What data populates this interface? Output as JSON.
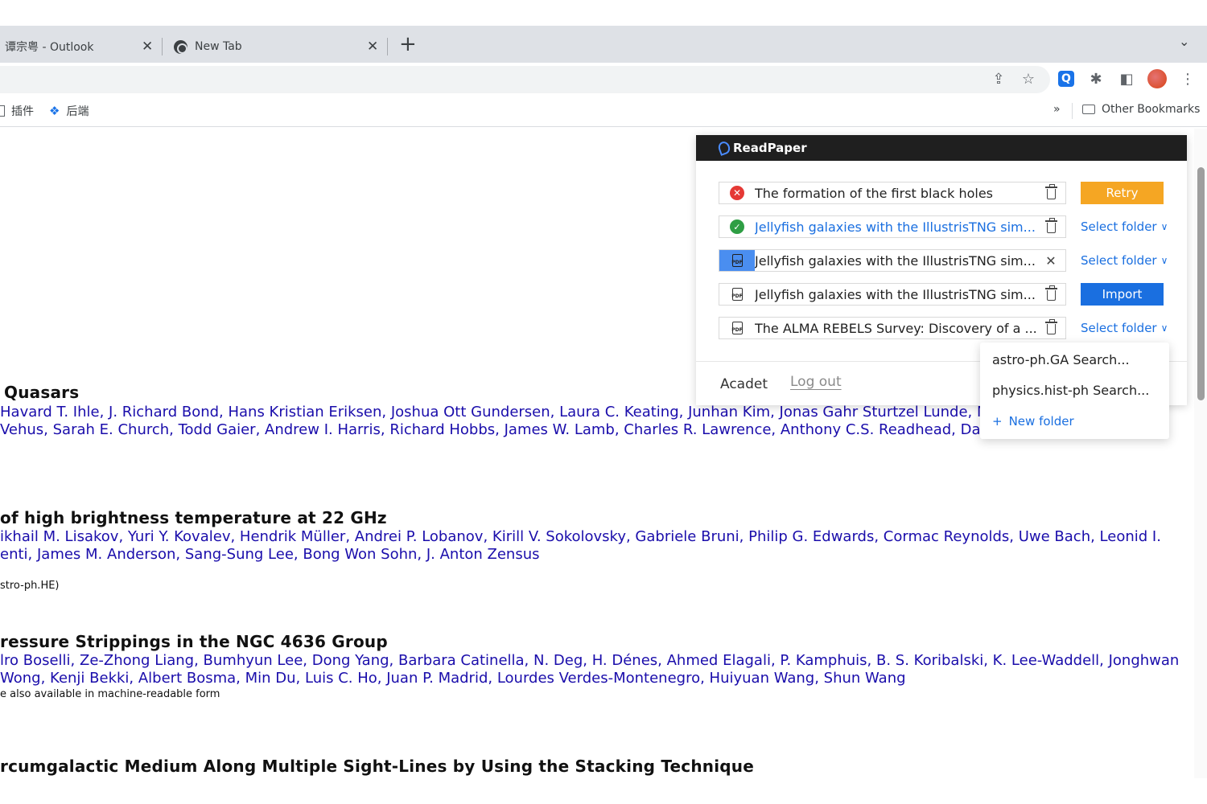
{
  "browser": {
    "tabs": [
      {
        "title": "谭宗粤 - Outlook"
      },
      {
        "title": "New Tab"
      }
    ],
    "new_tab_symbol": "+",
    "tab_menu_symbol": "⌄",
    "bookmarks": [
      {
        "label": "插件"
      },
      {
        "label": "后端"
      }
    ],
    "bookmarks_overflow": "»",
    "other_bookmarks": "Other Bookmarks",
    "extension_letter": "Q"
  },
  "papers": [
    {
      "title": "Quasars",
      "authors_line1": "Havard T. Ihle, J. Richard Bond, Hans Kristian Eriksen, Joshua Ott Gundersen, Laura C. Keating, Junhan Kim, Jonas Gahr Sturtzel Lunde, N",
      "authors_line2": "Vehus, Sarah E. Church, Todd Gaier, Andrew I. Harris, Richard Hobbs, James W. Lamb, Charles R. Lawrence, Anthony C.S. Readhead, Dav",
      "note": ""
    },
    {
      "title": "of high brightness temperature at 22 GHz",
      "authors_line1": "ikhail M. Lisakov, Yuri Y. Kovalev, Hendrik Müller, Andrei P. Lobanov, Kirill V. Sokolovsky, Gabriele Bruni, Philip G. Edwards, Cormac Reynolds, Uwe Bach, Leonid I.",
      "authors_line2": "enti, James M. Anderson, Sang-Sung Lee, Bong Won Sohn, J. Anton Zensus",
      "note": "stro-ph.HE)"
    },
    {
      "title": "ressure Strippings in the NGC 4636 Group",
      "authors_line1": "lro Boselli, Ze-Zhong Liang, Bumhyun Lee, Dong Yang, Barbara Catinella, N. Deg, H. Dénes, Ahmed Elagali, P. Kamphuis, B. S. Koribalski, K. Lee-Waddell, Jonghwan",
      "authors_line2": "Wong, Kenji Bekki, Albert Bosma, Min Du, Luis C. Ho, Juan P. Madrid, Lourdes Verdes-Montenegro, Huiyuan Wang, Shun Wang",
      "note": "e also available in machine-readable form"
    },
    {
      "title": "rcumgalactic Medium Along Multiple Sight-Lines by Using the Stacking Technique",
      "authors_line1": "",
      "authors_line2": "",
      "note": ""
    }
  ],
  "readpaper": {
    "brand": "ReadPaper",
    "items": [
      {
        "title": "The formation of the first black holes",
        "status": "error",
        "action": "Retry"
      },
      {
        "title": "Jellyfish galaxies with the IllustrisTNG sim...",
        "status": "success",
        "action": "Select folder"
      },
      {
        "title": "Jellyfish galaxies with the IllustrisTNG sim...",
        "status": "uploading",
        "action": "Select folder"
      },
      {
        "title": "Jellyfish galaxies with the IllustrisTNG sim...",
        "status": "pending",
        "action": "Import"
      },
      {
        "title": "The ALMA REBELS Survey: Discovery of a ...",
        "status": "pending",
        "action": "Select folder"
      }
    ],
    "user": "Acadet",
    "logout": "Log out",
    "folder_dropdown": {
      "options": [
        "astro-ph.GA Search...",
        "physics.hist-ph Search..."
      ],
      "new_folder": "New folder"
    }
  },
  "colors": {
    "accent": "#1a6fe0",
    "retry": "#f5a623",
    "error": "#e53935",
    "success": "#2e9e44",
    "link": "#0645ad"
  }
}
